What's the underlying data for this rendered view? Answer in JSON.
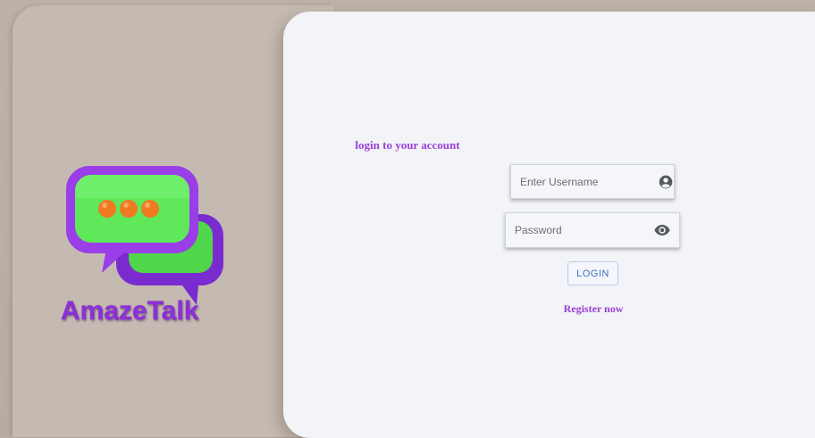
{
  "brand": {
    "name": "AmazeTalk",
    "color": "#8e2fdc"
  },
  "login_form": {
    "title": "login to your account",
    "username": {
      "placeholder": "Enter Username",
      "value": "",
      "icon": "account-circle-icon"
    },
    "password": {
      "placeholder": "Password",
      "value": "",
      "icon": "eye-icon"
    },
    "login_button": "LOGIN",
    "register_link": "Register now",
    "accent_color": "#9b3fd6",
    "button_color": "#3f6fb8"
  }
}
